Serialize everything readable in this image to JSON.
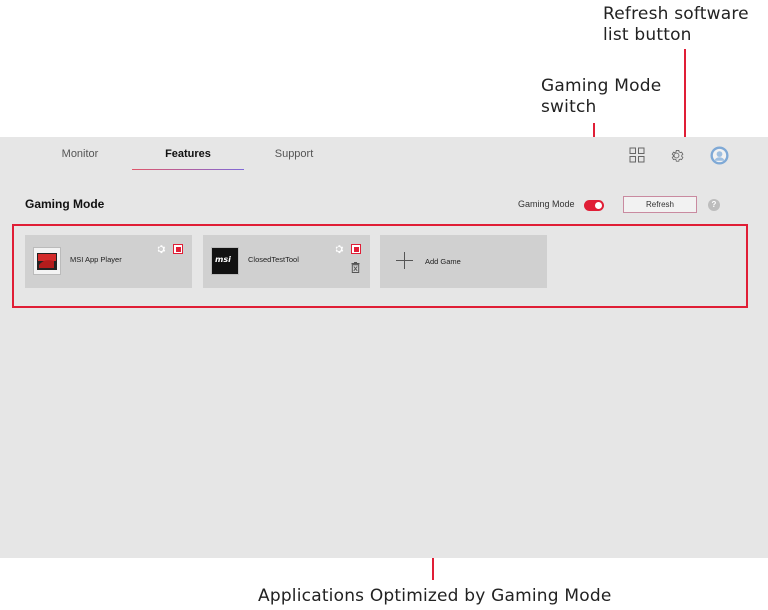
{
  "callouts": {
    "refresh": [
      "Refresh software",
      "list button"
    ],
    "gaming_mode": [
      "Gaming Mode",
      "switch"
    ],
    "applications": "Applications Optimized by Gaming Mode"
  },
  "nav": {
    "tabs": [
      {
        "label": "Monitor",
        "active": false
      },
      {
        "label": "Features",
        "active": true
      },
      {
        "label": "Support",
        "active": false
      }
    ]
  },
  "toolbar_icons": [
    "grid-icon",
    "gear-icon",
    "profile-icon"
  ],
  "section": {
    "title": "Gaming Mode",
    "switch_label": "Gaming Mode",
    "switch_on": true,
    "refresh_label": "Refresh",
    "help_glyph": "?"
  },
  "games": [
    {
      "name": "MSI App Player",
      "icon": "msi-app-player-icon",
      "has_delete": false
    },
    {
      "name": "ClosedTestTool",
      "icon": "msi-logo-icon",
      "logo_text": "msi",
      "has_delete": true
    }
  ],
  "add_game_label": "Add Game",
  "colors": {
    "accent": "#e01e36",
    "panel_bg": "#e6e6e6",
    "card_bg": "#d0d0d0"
  }
}
